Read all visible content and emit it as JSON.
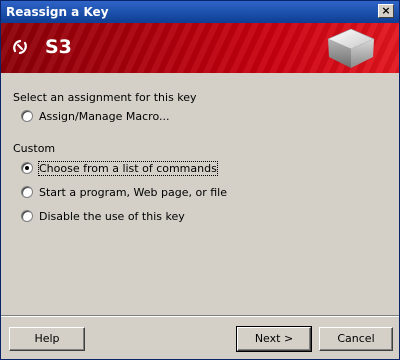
{
  "window": {
    "title": "Reassign a Key",
    "close_glyph": "×"
  },
  "banner": {
    "title": "S3",
    "logo_icon": "brand-logo-icon",
    "cube_icon": "key-cube-icon",
    "color_dark": "#8c0008",
    "color_light": "#e3161e"
  },
  "assignment_section": {
    "heading": "Select an assignment for this key",
    "options": [
      {
        "label": "Assign/Manage Macro...",
        "checked": false
      }
    ]
  },
  "custom_section": {
    "heading": "Custom",
    "options": [
      {
        "label": "Choose from a list of commands",
        "checked": true
      },
      {
        "label": "Start a program, Web page, or file",
        "checked": false
      },
      {
        "label": "Disable the use of this key",
        "checked": false
      }
    ]
  },
  "buttons": {
    "help": "Help",
    "next": "Next >",
    "cancel": "Cancel"
  }
}
